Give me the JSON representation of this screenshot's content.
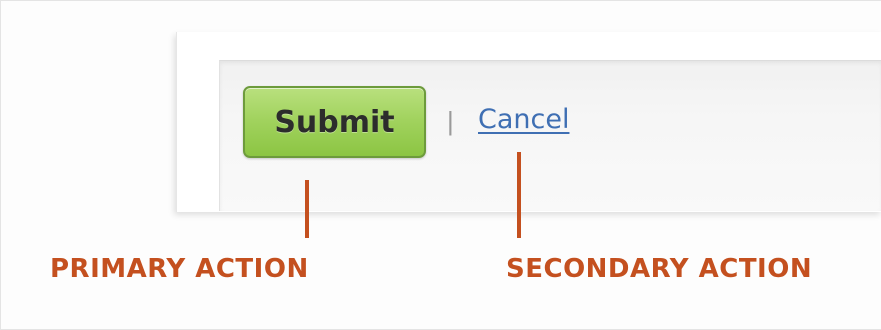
{
  "form": {
    "submit_label": "Submit",
    "separator": "|",
    "cancel_label": "Cancel"
  },
  "annotations": {
    "primary_label": "PRIMARY ACTION",
    "secondary_label": "SECONDARY ACTION"
  },
  "colors": {
    "submit_green": "#a2d35f",
    "submit_border": "#6d9b3c",
    "cancel_link_blue": "#3f6fb3",
    "annotation_orange": "#c4501f"
  }
}
